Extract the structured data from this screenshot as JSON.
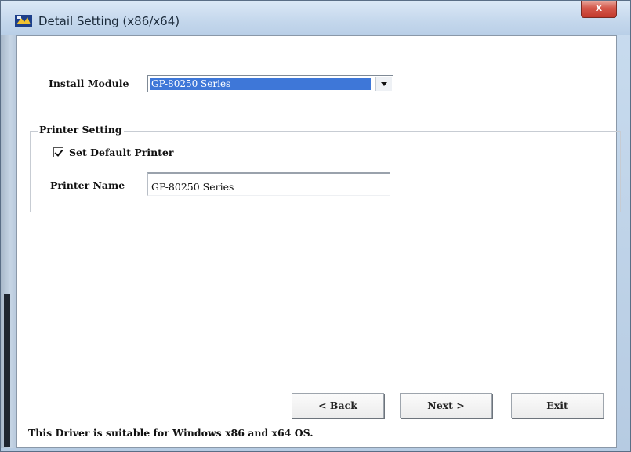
{
  "window": {
    "title": "Detail Setting (x86/x64)",
    "close_symbol": "x"
  },
  "install": {
    "label": "Install Module",
    "selected": "GP-80250 Series"
  },
  "printer_setting": {
    "group_title": "Printer Setting",
    "set_default_label": "Set Default Printer",
    "set_default_checked": true,
    "name_label": "Printer Name",
    "name_value": "GP-80250 Series"
  },
  "buttons": {
    "back": "< Back",
    "next": "Next >",
    "exit": "Exit"
  },
  "footer": {
    "note": "This Driver is suitable for Windows x86 and x64 OS."
  },
  "colors": {
    "selection": "#3e77d8",
    "close_button": "#c2392c"
  }
}
